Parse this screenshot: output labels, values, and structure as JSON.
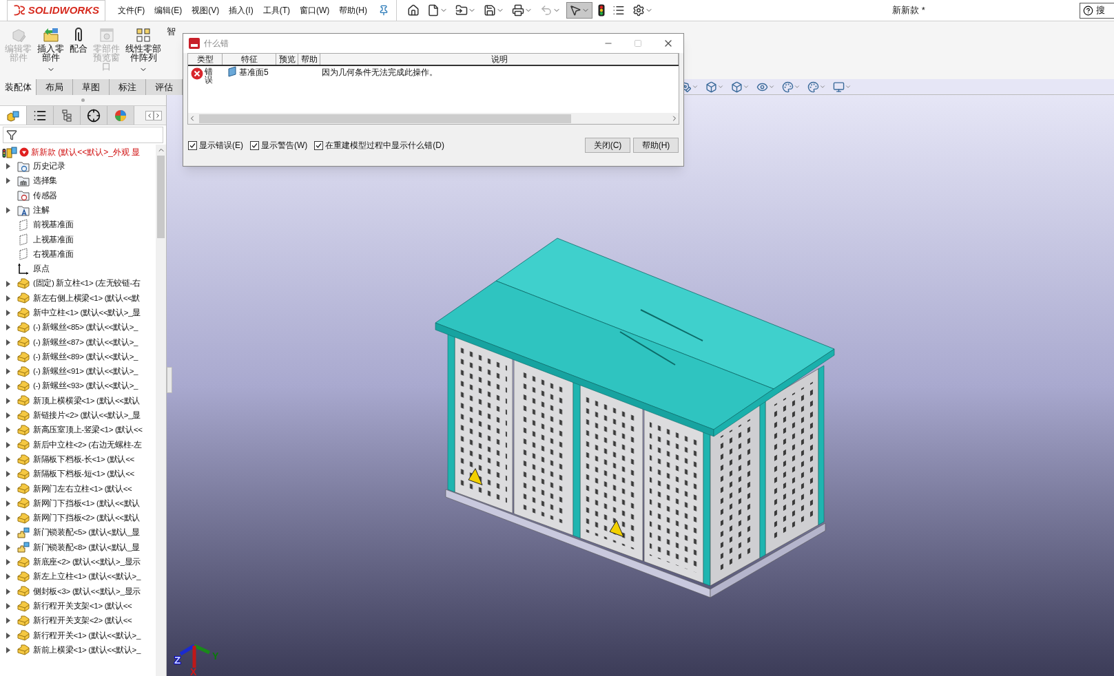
{
  "logo_text": "SOLIDWORKS",
  "menu": [
    "文件(F)",
    "编辑(E)",
    "视图(V)",
    "插入(I)",
    "工具(T)",
    "窗口(W)",
    "帮助(H)"
  ],
  "quick_access": [
    {
      "kind": "home",
      "dropdown": false,
      "disabled": false,
      "selected": false
    },
    {
      "kind": "new",
      "dropdown": true,
      "disabled": false,
      "selected": false
    },
    {
      "kind": "open",
      "dropdown": true,
      "disabled": false,
      "selected": false
    },
    {
      "kind": "save",
      "dropdown": true,
      "disabled": false,
      "selected": false
    },
    {
      "kind": "print",
      "dropdown": true,
      "disabled": false,
      "selected": false
    },
    {
      "kind": "undo",
      "dropdown": true,
      "disabled": true,
      "selected": false
    },
    {
      "kind": "select",
      "dropdown": true,
      "disabled": false,
      "selected": true
    },
    {
      "kind": "rebuild",
      "dropdown": false,
      "disabled": false,
      "selected": false
    },
    {
      "kind": "file-properties",
      "dropdown": false,
      "disabled": false,
      "selected": false
    },
    {
      "kind": "options",
      "dropdown": true,
      "disabled": false,
      "selected": false
    }
  ],
  "document_title": "新新款 *",
  "search_label": "搜",
  "command_buttons": [
    {
      "label": "编辑零部件",
      "kind": "edit",
      "disabled": true,
      "dropdown": false
    },
    {
      "label": "插入零部件",
      "kind": "insert",
      "disabled": false,
      "dropdown": true
    },
    {
      "label": "配合",
      "kind": "mate",
      "disabled": false,
      "dropdown": false
    },
    {
      "label": "零部件预览窗口",
      "kind": "preview",
      "disabled": true,
      "dropdown": false
    },
    {
      "label": "线性零部件阵列",
      "kind": "pattern",
      "disabled": false,
      "dropdown": true
    },
    {
      "label": "智",
      "kind": "smart",
      "disabled": false,
      "dropdown": false
    }
  ],
  "tabs": [
    {
      "label": "装配体",
      "selected": true
    },
    {
      "label": "布局",
      "selected": false
    },
    {
      "label": "草图",
      "selected": false
    },
    {
      "label": "标注",
      "selected": false
    },
    {
      "label": "评估",
      "selected": false
    }
  ],
  "panel_tabs": [
    {
      "kind": "feature-manager",
      "selected": true
    },
    {
      "kind": "property-manager",
      "selected": false
    },
    {
      "kind": "configuration-manager",
      "selected": false
    },
    {
      "kind": "dimxpert",
      "selected": false
    },
    {
      "kind": "display-manager",
      "selected": false
    }
  ],
  "feature_tree": {
    "root": {
      "label": "新新款  (默认<<默认>_外观 显",
      "error": true
    },
    "items": [
      {
        "kind": "history",
        "label": "历史记录",
        "expandable": true
      },
      {
        "kind": "selection-sets",
        "label": "选择集",
        "expandable": true
      },
      {
        "kind": "sensors",
        "label": "传感器",
        "expandable": false
      },
      {
        "kind": "annotations",
        "label": "注解",
        "expandable": true
      },
      {
        "kind": "plane",
        "label": "前视基准面",
        "expandable": false
      },
      {
        "kind": "plane",
        "label": "上视基准面",
        "expandable": false
      },
      {
        "kind": "plane",
        "label": "右视基准面",
        "expandable": false
      },
      {
        "kind": "origin",
        "label": "原点",
        "expandable": false
      },
      {
        "kind": "part",
        "label": "(固定) 新立柱<1> (左无铰链-右",
        "expandable": true
      },
      {
        "kind": "part",
        "label": "新左右侧上横梁<1> (默认<<默",
        "expandable": true
      },
      {
        "kind": "part",
        "label": "新中立柱<1> (默认<<默认>_显",
        "expandable": true
      },
      {
        "kind": "part",
        "label": "(-) 新螺丝<85> (默认<<默认>_",
        "expandable": true
      },
      {
        "kind": "part",
        "label": "(-) 新螺丝<87> (默认<<默认>_",
        "expandable": true
      },
      {
        "kind": "part",
        "label": "(-) 新螺丝<89> (默认<<默认>_",
        "expandable": true
      },
      {
        "kind": "part",
        "label": "(-) 新螺丝<91> (默认<<默认>_",
        "expandable": true
      },
      {
        "kind": "part",
        "label": "(-) 新螺丝<93> (默认<<默认>_",
        "expandable": true
      },
      {
        "kind": "part",
        "label": "新顶上横横梁<1> (默认<<默认",
        "expandable": true
      },
      {
        "kind": "part",
        "label": "新链接片<2> (默认<<默认>_显",
        "expandable": true
      },
      {
        "kind": "part",
        "label": "新高压室顶上-竖梁<1> (默认<<",
        "expandable": true
      },
      {
        "kind": "part",
        "label": "新后中立柱<2> (右边无螺柱-左",
        "expandable": true
      },
      {
        "kind": "part",
        "label": "新隔板下档板-长<1> (默认<<",
        "expandable": true
      },
      {
        "kind": "part",
        "label": "新隔板下档板-短<1> (默认<<",
        "expandable": true
      },
      {
        "kind": "part",
        "label": "新网门左右立柱<1> (默认<<",
        "expandable": true
      },
      {
        "kind": "part",
        "label": "新网门下挡板<1> (默认<<默认",
        "expandable": true
      },
      {
        "kind": "part",
        "label": "新网门下挡板<2> (默认<<默认",
        "expandable": true
      },
      {
        "kind": "subassembly",
        "label": "新门锁装配<5> (默认<默认_显",
        "expandable": true
      },
      {
        "kind": "subassembly",
        "label": "新门锁装配<8> (默认<默认_显",
        "expandable": true
      },
      {
        "kind": "part",
        "label": "新底座<2> (默认<<默认>_显示",
        "expandable": true
      },
      {
        "kind": "part",
        "label": "新左上立柱<1> (默认<<默认>_",
        "expandable": true
      },
      {
        "kind": "part",
        "label": "侧封板<3> (默认<<默认>_显示",
        "expandable": true
      },
      {
        "kind": "part",
        "label": "新行程开关支架<1> (默认<<",
        "expandable": true
      },
      {
        "kind": "part",
        "label": "新行程开关支架<2> (默认<<",
        "expandable": true
      },
      {
        "kind": "part",
        "label": "新行程开关<1> (默认<<默认>_",
        "expandable": true
      },
      {
        "kind": "part",
        "label": "新前上横梁<1> (默认<<默认>_",
        "expandable": true
      }
    ]
  },
  "dialog": {
    "title": "什么错",
    "columns": [
      "类型",
      "特征",
      "预览",
      "帮助",
      "说明"
    ],
    "rows": [
      {
        "type": "错误",
        "feature": "基准面5",
        "description": "因为几何条件无法完成此操作。"
      }
    ],
    "options": [
      {
        "label": "显示错误(E)",
        "checked": true
      },
      {
        "label": "显示警告(W)",
        "checked": true
      },
      {
        "label": "在重建模型过程中显示什么错(D)",
        "checked": true
      }
    ],
    "buttons": [
      "关闭(C)",
      "帮助(H)"
    ]
  },
  "triad": [
    "Z",
    "Y",
    "X"
  ]
}
